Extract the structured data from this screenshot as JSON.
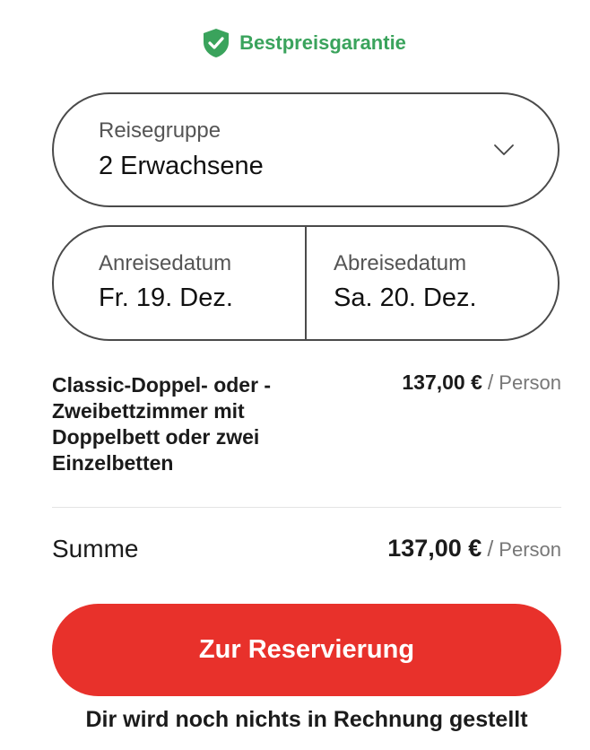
{
  "badge": {
    "text": "Bestpreisgarantie",
    "icon": "shield-check-icon",
    "color": "#3aa35c"
  },
  "travel_group": {
    "label": "Reisegruppe",
    "value": "2 Erwachsene"
  },
  "dates": {
    "arrival_label": "Anreisedatum",
    "arrival_value": "Fr. 19. Dez.",
    "departure_label": "Abreisedatum",
    "departure_value": "Sa. 20. Dez."
  },
  "room": {
    "name": "Classic-Doppel- oder -Zweibettzimmer mit Doppelbett oder zwei Einzelbetten",
    "price": "137,00 €",
    "separator": "/",
    "per": "Person"
  },
  "total": {
    "label": "Summe",
    "price": "137,00 €",
    "separator": "/",
    "per": "Person"
  },
  "cta": {
    "label": "Zur Reservierung",
    "color": "#e8312b"
  },
  "note": "Dir wird noch nichts in Rechnung gestellt"
}
